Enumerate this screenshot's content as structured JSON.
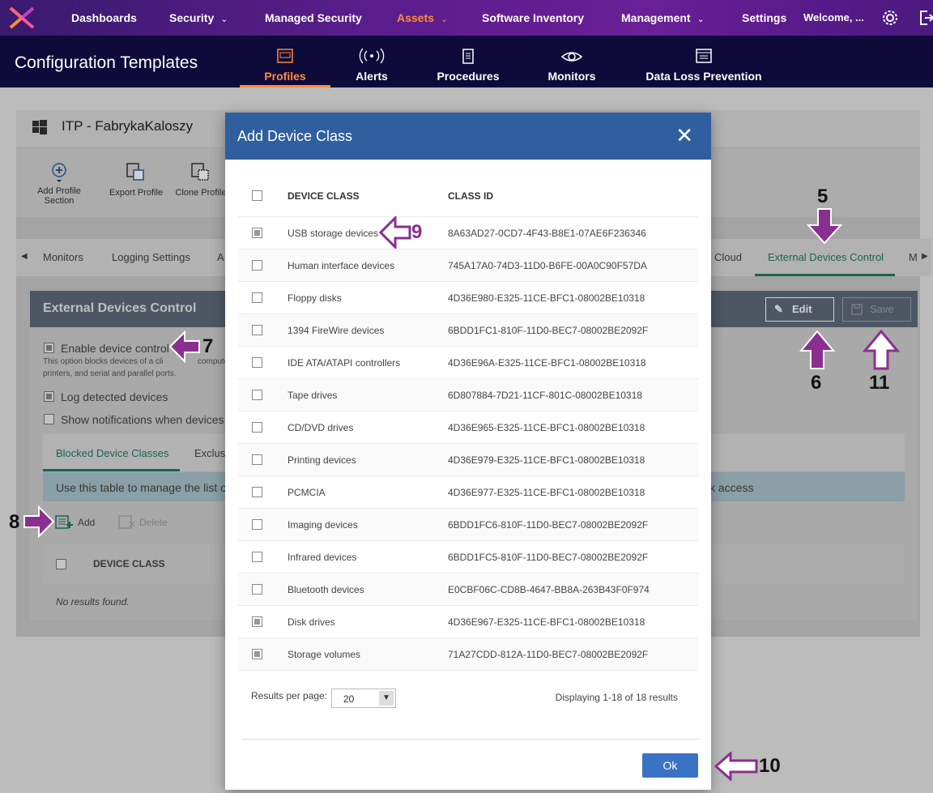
{
  "topnav": {
    "items": [
      "Dashboards",
      "Security",
      "Managed Security",
      "Assets",
      "Software Inventory",
      "Management",
      "Settings"
    ],
    "welcome": "Welcome, ...",
    "accent": "#ff8c3a"
  },
  "subheader": {
    "title": "Configuration Templates",
    "tabs": [
      "Profiles",
      "Alerts",
      "Procedures",
      "Monitors",
      "Data Loss Prevention"
    ]
  },
  "background": {
    "profile_title": "ITP - FabrykaKaloszy",
    "toolbar": [
      "Add Profile Section",
      "Export Profile",
      "Clone Profile"
    ],
    "tabs": [
      "Monitors",
      "Logging Settings",
      "A",
      "Cloud",
      "External Devices Control",
      "M"
    ],
    "section_title": "External Devices Control",
    "edit_label": "Edit",
    "save_label": "Save",
    "enable_device_control": "Enable device control",
    "enable_desc_1": "This option blocks devices of a cli",
    "enable_desc_1b": "compute",
    "enable_desc_2": "printers, and serial and parallel ports.",
    "log_detected": "Log detected devices",
    "show_notifications": "Show notifications when devices",
    "subtabs": [
      "Blocked Device Classes",
      "Exclus"
    ],
    "info": "Use this table to manage the list o",
    "info_tail": "k access",
    "add_label": "Add",
    "delete_label": "Delete",
    "col_device_class": "DEVICE CLASS",
    "no_results": "No results found."
  },
  "modal": {
    "title": "Add Device Class",
    "columns": [
      "DEVICE CLASS",
      "CLASS ID"
    ],
    "rows": [
      {
        "name": "USB storage devices",
        "id": "8A63AD27-0CD7-4F43-B8E1-07AE6F236346",
        "checked": true
      },
      {
        "name": "Human interface devices",
        "id": "745A17A0-74D3-11D0-B6FE-00A0C90F57DA",
        "checked": false
      },
      {
        "name": "Floppy disks",
        "id": "4D36E980-E325-11CE-BFC1-08002BE10318",
        "checked": false
      },
      {
        "name": "1394 FireWire devices",
        "id": "6BDD1FC1-810F-11D0-BEC7-08002BE2092F",
        "checked": false
      },
      {
        "name": "IDE ATA/ATAPI controllers",
        "id": "4D36E96A-E325-11CE-BFC1-08002BE10318",
        "checked": false
      },
      {
        "name": "Tape drives",
        "id": "6D807884-7D21-11CF-801C-08002BE10318",
        "checked": false
      },
      {
        "name": "CD/DVD drives",
        "id": "4D36E965-E325-11CE-BFC1-08002BE10318",
        "checked": false
      },
      {
        "name": "Printing devices",
        "id": "4D36E979-E325-11CE-BFC1-08002BE10318",
        "checked": false
      },
      {
        "name": "PCMCIA",
        "id": "4D36E977-E325-11CE-BFC1-08002BE10318",
        "checked": false
      },
      {
        "name": "Imaging devices",
        "id": "6BDD1FC6-810F-11D0-BEC7-08002BE2092F",
        "checked": false
      },
      {
        "name": "Infrared devices",
        "id": "6BDD1FC5-810F-11D0-BEC7-08002BE2092F",
        "checked": false
      },
      {
        "name": "Bluetooth devices",
        "id": "E0CBF06C-CD8B-4647-BB8A-263B43F0F974",
        "checked": false
      },
      {
        "name": "Disk drives",
        "id": "4D36E967-E325-11CE-BFC1-08002BE10318",
        "checked": true
      },
      {
        "name": "Storage volumes",
        "id": "71A27CDD-812A-11D0-BEC7-08002BE2092F",
        "checked": true
      }
    ],
    "results_per_page_label": "Results per page:",
    "results_per_page": "20",
    "displaying": "Displaying 1-18 of 18 results",
    "ok_label": "Ok"
  },
  "annotations": {
    "n5": "5",
    "n6": "6",
    "n7": "7",
    "n8": "8",
    "n9": "9",
    "n10": "10",
    "n11": "11",
    "arrow_color": "#8a2f8f"
  }
}
